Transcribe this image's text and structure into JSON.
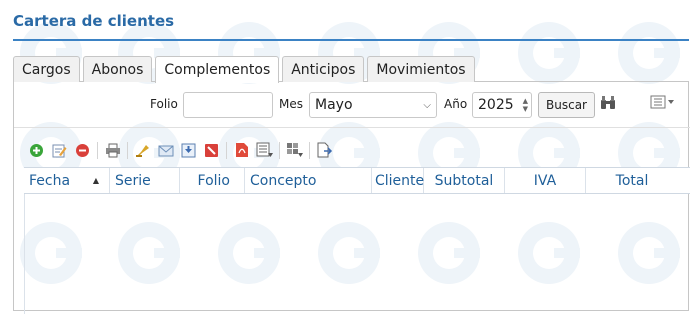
{
  "page": {
    "title": "Cartera de clientes"
  },
  "tabs": [
    {
      "label": "Cargos",
      "active": false
    },
    {
      "label": "Abonos",
      "active": false
    },
    {
      "label": "Complementos",
      "active": true
    },
    {
      "label": "Anticipos",
      "active": false
    },
    {
      "label": "Movimientos",
      "active": false
    }
  ],
  "filters": {
    "folio_label": "Folio",
    "folio_value": "",
    "mes_label": "Mes",
    "mes_value": "Mayo",
    "anio_label": "Año",
    "anio_value": "2025",
    "search_label": "Buscar"
  },
  "toolbar": {
    "icons": [
      "add-icon",
      "edit-icon",
      "delete-icon",
      "print-icon",
      "stamp-icon",
      "email-icon",
      "download-icon",
      "cancel-icon",
      "pdf-icon",
      "list-icon",
      "grid-export-icon",
      "document-export-icon"
    ]
  },
  "grid": {
    "columns": [
      "Fecha",
      "Serie",
      "Folio",
      "Concepto",
      "Cliente",
      "Subtotal",
      "IVA",
      "Total"
    ],
    "sorted_column": "Fecha",
    "sort_direction": "asc",
    "rows": []
  },
  "colors": {
    "accent": "#2a6aa6",
    "rule": "#3b82c4",
    "header_text": "#1f5f99"
  }
}
